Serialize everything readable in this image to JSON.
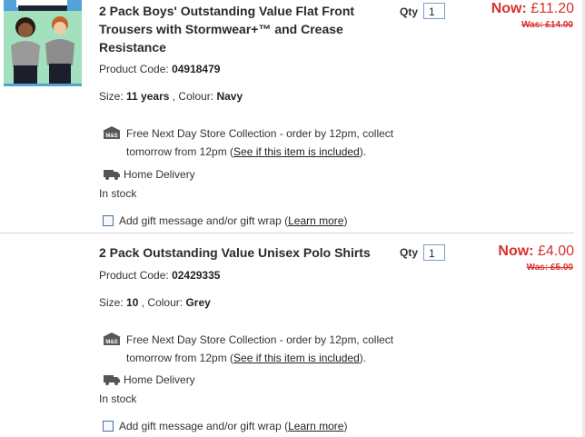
{
  "items": [
    {
      "title": "2 Pack Boys' Outstanding Value Flat Front Trousers with Stormwear+™ and Crease Resistance",
      "qty_label": "Qty",
      "qty_value": "1",
      "price_now_label": "Now:",
      "price_now": "£11.20",
      "price_was": "Was: £14.00",
      "product_code_label": "Product Code:",
      "product_code": "04918479",
      "size_label": "Size:",
      "size": "11 years",
      "colour_label": ", Colour:",
      "colour": "Navy",
      "collection_text": "Free Next Day Store Collection - order by 12pm, collect tomorrow from 12pm (",
      "collection_link": "See if this item is included",
      "collection_end": ").",
      "collection_icon": "ms-store-icon",
      "delivery": "Home Delivery",
      "delivery_icon": "truck-icon",
      "stock": "In stock",
      "gift_text": "Add gift message and/or gift wrap (",
      "gift_link": "Learn more",
      "gift_end": ")"
    },
    {
      "title": "2 Pack Outstanding Value Unisex Polo Shirts",
      "qty_label": "Qty",
      "qty_value": "1",
      "price_now_label": "Now:",
      "price_now": "£4.00",
      "price_was": "Was: £5.00",
      "product_code_label": "Product Code:",
      "product_code": "02429335",
      "size_label": "Size:",
      "size": "10",
      "colour_label": ", Colour:",
      "colour": "Grey",
      "collection_text": "Free Next Day Store Collection - order by 12pm, collect tomorrow from 12pm (",
      "collection_link": "See if this item is included",
      "collection_end": ").",
      "collection_icon": "ms-store-icon",
      "delivery": "Home Delivery",
      "delivery_icon": "truck-icon",
      "stock": "In stock",
      "gift_text": "Add gift message and/or gift wrap (",
      "gift_link": "Learn more",
      "gift_end": ")"
    }
  ],
  "colors": {
    "price": "#d8302c",
    "checkbox_border": "#4a6f9c",
    "qty_border": "#7a9cc6"
  }
}
